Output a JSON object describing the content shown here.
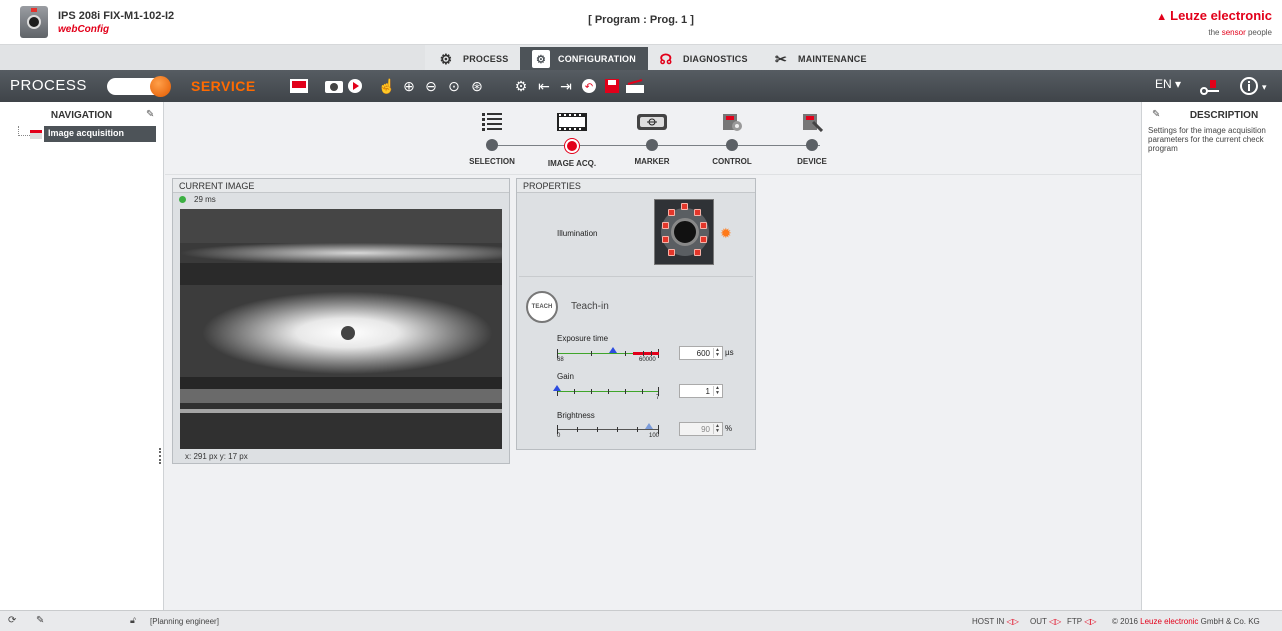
{
  "header": {
    "device_name": "IPS 208i FIX-M1-102-I2",
    "app_name": "webConfig",
    "program": "[ Program : Prog. 1 ]",
    "brand": "Leuze electronic",
    "tagline_prefix": "the",
    "tagline_accent": "sensor",
    "tagline_suffix": "people"
  },
  "tabs": [
    {
      "label": "PROCESS",
      "icon": "gear-icon",
      "active": false
    },
    {
      "label": "CONFIGURATION",
      "icon": "configuration-icon",
      "active": true
    },
    {
      "label": "DIAGNOSTICS",
      "icon": "stethoscope-icon",
      "active": false
    },
    {
      "label": "MAINTENANCE",
      "icon": "tools-icon",
      "active": false
    }
  ],
  "toolbar": {
    "mode_label": "PROCESS",
    "service_label": "SERVICE",
    "language": "EN"
  },
  "navigation": {
    "title": "NAVIGATION",
    "items": [
      {
        "label": "Image acquisition"
      }
    ]
  },
  "description": {
    "title": "DESCRIPTION",
    "text": "Settings for the image acquisition parameters for the current check program"
  },
  "steps": [
    {
      "label": "SELECTION",
      "icon": "list-icon"
    },
    {
      "label": "IMAGE ACQ.",
      "icon": "film-icon",
      "active": true
    },
    {
      "label": "MARKER",
      "icon": "marker-icon"
    },
    {
      "label": "CONTROL",
      "icon": "control-icon"
    },
    {
      "label": "DEVICE",
      "icon": "device-icon"
    }
  ],
  "current_image": {
    "title": "CURRENT IMAGE",
    "timing": "29 ms",
    "coords": "x: 291 px y: 17 px"
  },
  "properties": {
    "title": "PROPERTIES",
    "illumination_label": "Illumination",
    "teach_label": "Teach-in",
    "teach_button": "TEACH",
    "exposure": {
      "label": "Exposure time",
      "min": "68",
      "max": "60000",
      "value": "600",
      "unit": "µs"
    },
    "gain": {
      "label": "Gain",
      "min": "1",
      "max": "7",
      "value": "1"
    },
    "brightness": {
      "label": "Brightness",
      "min": "0",
      "max": "100",
      "value": "90",
      "unit": "%"
    }
  },
  "status": {
    "user": "[Planning engineer]",
    "host_in": "HOST IN",
    "out": "OUT",
    "ftp": "FTP",
    "copyright_prefix": "© 2016",
    "copyright_brand": "Leuze electronic",
    "copyright_suffix": "GmbH & Co. KG"
  },
  "colors": {
    "accent": "#e2001a",
    "service": "#ff6a00",
    "toolbar": "#4d5358"
  }
}
